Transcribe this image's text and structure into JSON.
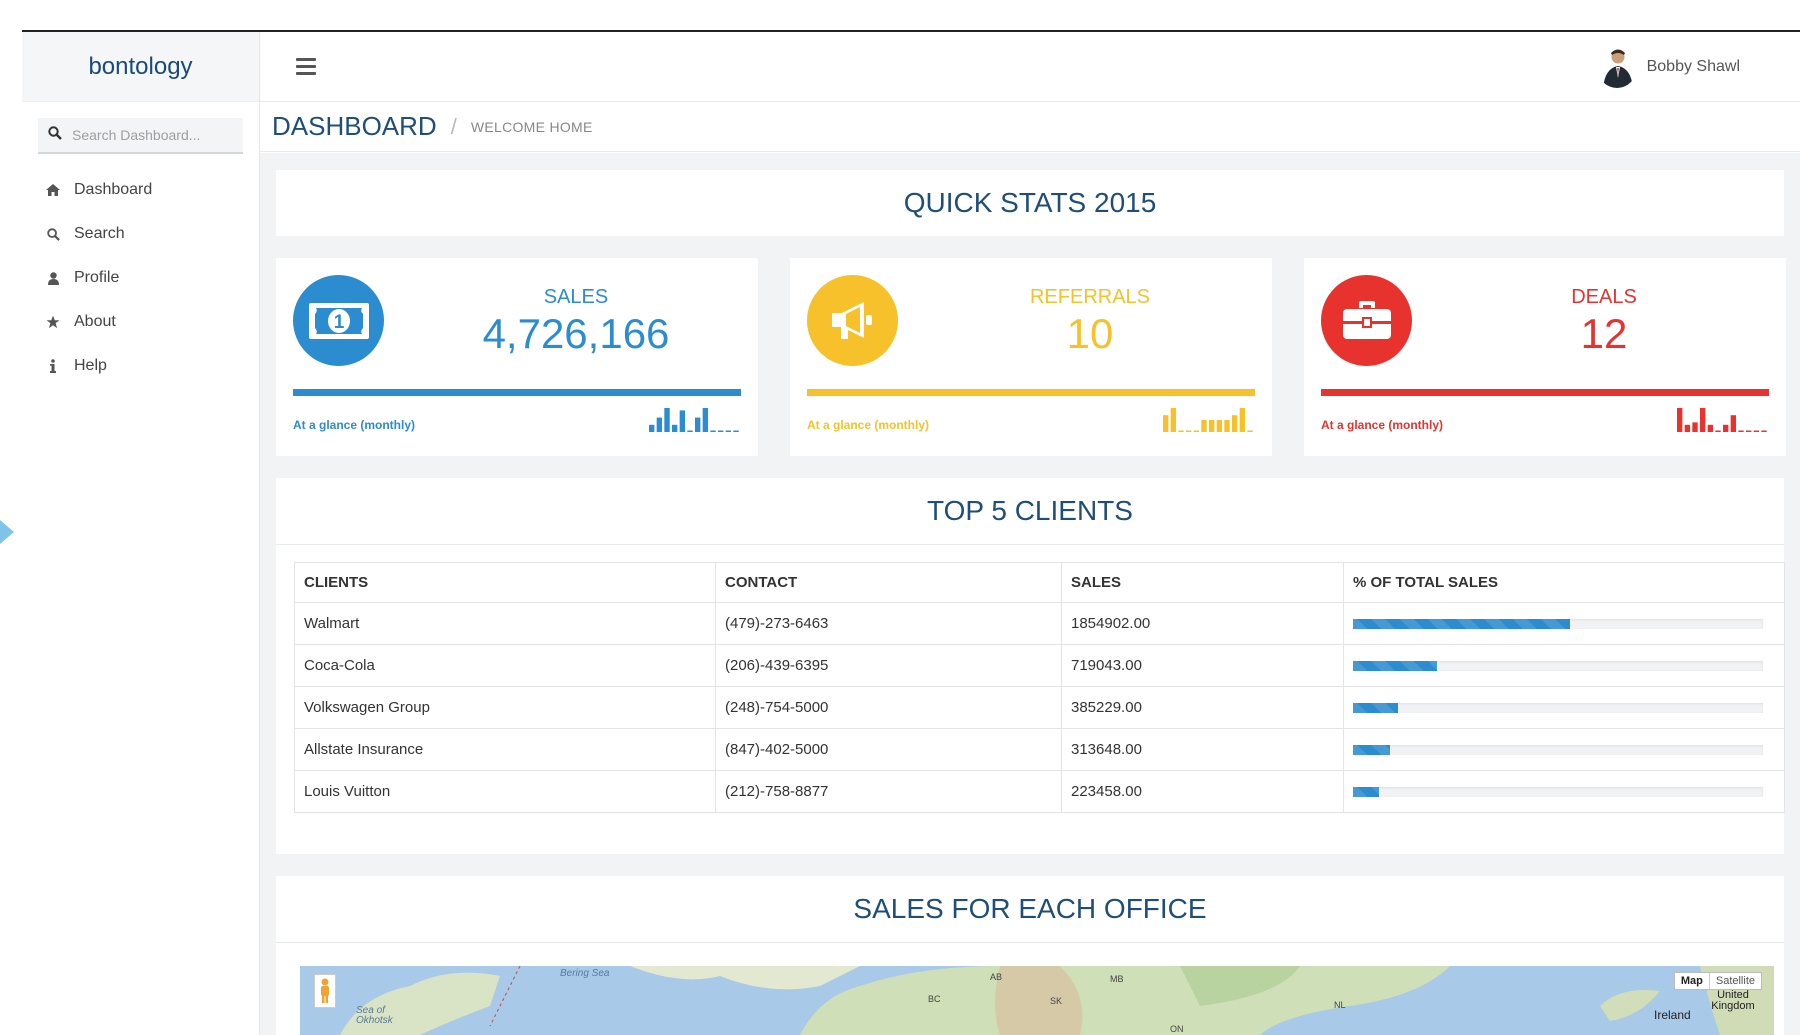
{
  "brand": "bontology",
  "search": {
    "placeholder": "Search Dashboard..."
  },
  "sidebar": {
    "items": [
      {
        "label": "Dashboard",
        "icon": "home-icon"
      },
      {
        "label": "Search",
        "icon": "search-icon"
      },
      {
        "label": "Profile",
        "icon": "user-icon"
      },
      {
        "label": "About",
        "icon": "star-icon"
      },
      {
        "label": "Help",
        "icon": "info-icon"
      }
    ]
  },
  "header": {
    "user_name": "Bobby Shawl"
  },
  "breadcrumb": {
    "title": "DASHBOARD",
    "separator": "/",
    "sub": "WELCOME HOME"
  },
  "quick_stats": {
    "title": "QUICK STATS 2015",
    "cards": [
      {
        "label": "SALES",
        "value": "4,726,166",
        "glance": "At a glance (monthly)",
        "color": "#2b8ccf",
        "icon": "money-icon",
        "spark": [
          3,
          6,
          10,
          3,
          9,
          0,
          6,
          10,
          0,
          0,
          0,
          0
        ]
      },
      {
        "label": "REFERRALS",
        "value": "10",
        "glance": "At a glance (monthly)",
        "color": "#f6c12a",
        "icon": "megaphone-icon",
        "spark": [
          7,
          10,
          0,
          0,
          0,
          5,
          5,
          5,
          5,
          7,
          10,
          0
        ]
      },
      {
        "label": "DEALS",
        "value": "12",
        "glance": "At a glance (monthly)",
        "color": "#e8322d",
        "icon": "briefcase-icon",
        "spark": [
          10,
          3,
          4,
          10,
          3,
          0,
          3,
          7,
          0,
          0,
          0,
          0
        ]
      }
    ]
  },
  "top_clients": {
    "title": "TOP 5 CLIENTS",
    "columns": [
      "CLIENTS",
      "CONTACT",
      "SALES",
      "% OF TOTAL SALES"
    ],
    "rows": [
      {
        "client": "Walmart",
        "contact": "(479)-273-6463",
        "sales": "1854902.00",
        "pct": 0.53
      },
      {
        "client": "Coca-Cola",
        "contact": "(206)-439-6395",
        "sales": "719043.00",
        "pct": 0.205
      },
      {
        "client": "Volkswagen Group",
        "contact": "(248)-754-5000",
        "sales": "385229.00",
        "pct": 0.11
      },
      {
        "client": "Allstate Insurance",
        "contact": "(847)-402-5000",
        "sales": "313648.00",
        "pct": 0.09
      },
      {
        "client": "Louis Vuitton",
        "contact": "(212)-758-8877",
        "sales": "223458.00",
        "pct": 0.064
      }
    ]
  },
  "office_sales": {
    "title": "SALES FOR EACH OFFICE",
    "map_buttons": [
      "Map",
      "Satellite"
    ],
    "map_labels": [
      "Bering Sea",
      "Sea of Okhotsk",
      "AB",
      "MB",
      "BC",
      "SK",
      "NL",
      "ON",
      "Ireland",
      "United Kingdom"
    ]
  }
}
